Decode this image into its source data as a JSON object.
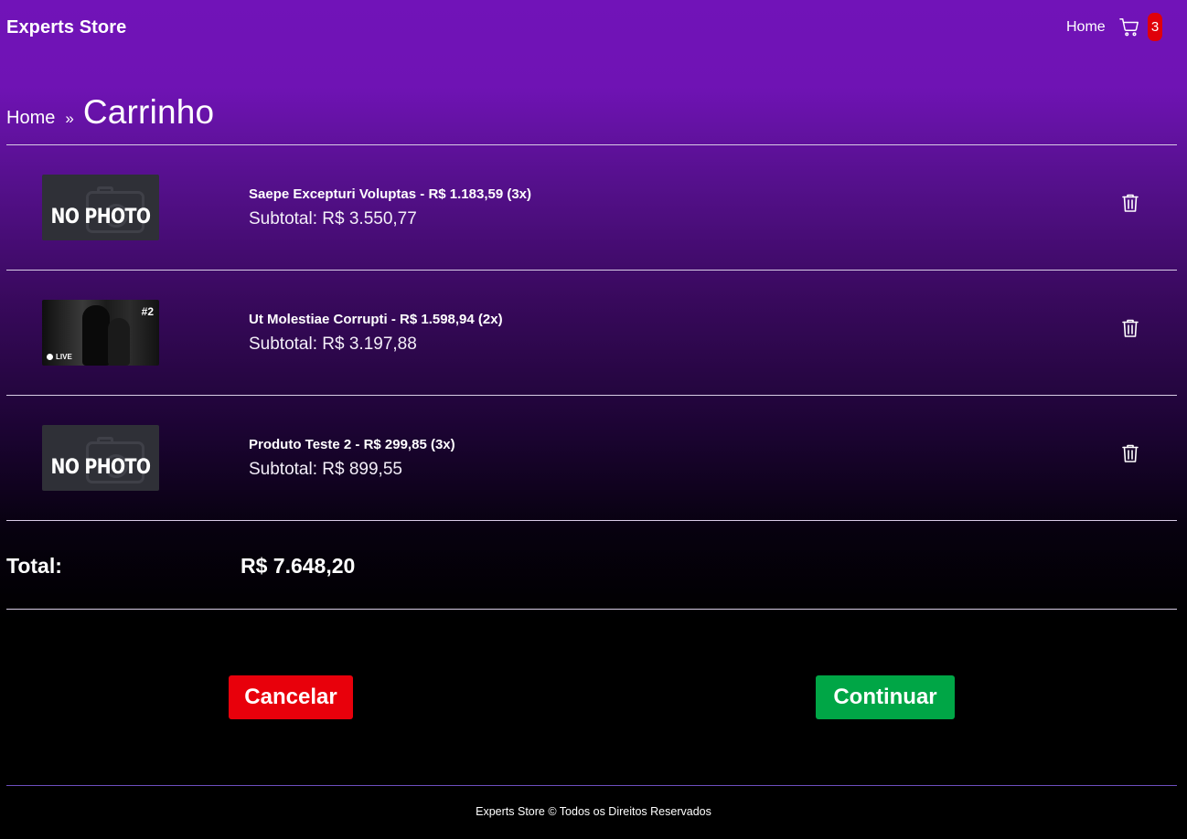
{
  "header": {
    "brand": "Experts Store",
    "nav_home": "Home",
    "cart_icon": "shopping-cart-icon",
    "cart_count": "3"
  },
  "breadcrumb": {
    "home": "Home",
    "separator": "»",
    "current": "Carrinho"
  },
  "cart": {
    "items": [
      {
        "title": "Saepe Excepturi Voluptas - R$ 1.183,59 (3x)",
        "subtotal": "Subtotal: R$ 3.550,77",
        "image_label": "NO PHOTO",
        "image_type": "placeholder",
        "remove_icon": "trash-icon"
      },
      {
        "title": "Ut Molestiae Corrupti - R$ 1.598,94 (2x)",
        "subtotal": "Subtotal: R$ 3.197,88",
        "image_tag": "#2",
        "image_badge": "LIVE",
        "image_type": "photo",
        "remove_icon": "trash-icon"
      },
      {
        "title": "Produto Teste 2 - R$ 299,85 (3x)",
        "subtotal": "Subtotal: R$ 899,55",
        "image_label": "NO PHOTO",
        "image_type": "placeholder",
        "remove_icon": "trash-icon"
      }
    ],
    "total_label": "Total:",
    "total_value": "R$ 7.648,20"
  },
  "actions": {
    "cancel_label": "Cancelar",
    "continue_label": "Continuar",
    "cancel_color": "#e8000b",
    "continue_color": "#00a646"
  },
  "footer": {
    "text": "Experts Store © Todos os Direitos Reservados"
  }
}
